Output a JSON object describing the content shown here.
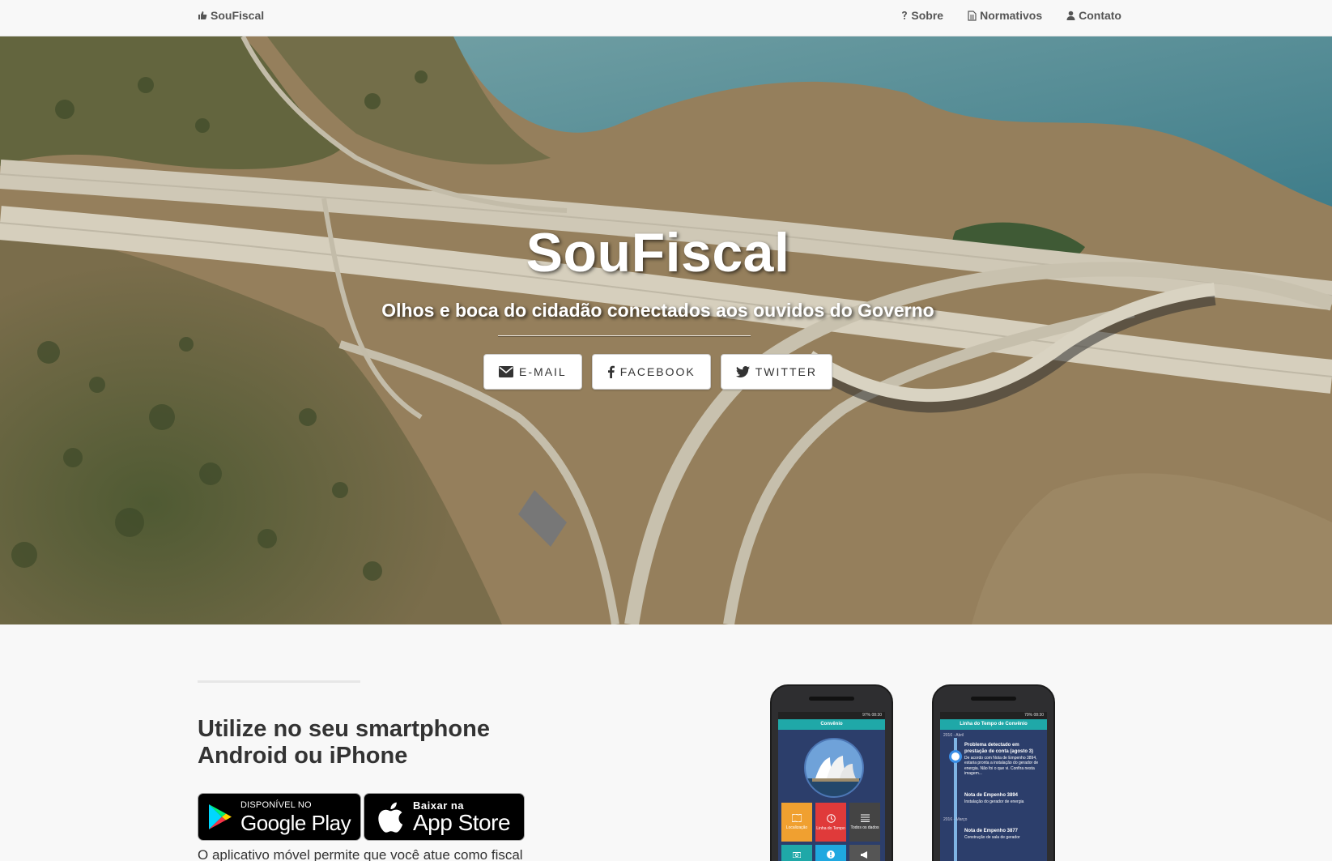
{
  "navbar": {
    "brand": "SouFiscal",
    "brand_icon": "thumbs-up-icon",
    "links": [
      {
        "label": "Sobre",
        "icon": "question-icon"
      },
      {
        "label": "Normativos",
        "icon": "file-icon"
      },
      {
        "label": "Contato",
        "icon": "user-icon"
      }
    ]
  },
  "hero": {
    "title": "SouFiscal",
    "subtitle": "Olhos e boca do cidadão conectados aos ouvidos do Governo",
    "buttons": [
      {
        "label": "E-MAIL",
        "icon": "envelope-icon"
      },
      {
        "label": "FACEBOOK",
        "icon": "facebook-icon"
      },
      {
        "label": "TWITTER",
        "icon": "twitter-icon"
      }
    ]
  },
  "section": {
    "heading": "Utilize no seu smartphone Android ou iPhone",
    "google_play": {
      "small": "DISPONÍVEL NO",
      "big": "Google Play"
    },
    "app_store": {
      "small": "Baixar na",
      "big": "App Store"
    },
    "lead": "O aplicativo móvel permite que você atue como fiscal"
  },
  "phone1": {
    "status": "97% 08:30",
    "title": "Convênio",
    "tiles": [
      {
        "label": "Localização",
        "color": "#f0a030"
      },
      {
        "label": "Linha do Tempo",
        "color": "#e03a3a"
      },
      {
        "label": "Todos os dados",
        "color": "#444"
      }
    ]
  },
  "phone2": {
    "status": "79% 08:30",
    "title": "Linha do Tempo de Convênio",
    "dates": [
      "2016 - Abril",
      "2016 - Março"
    ],
    "items": [
      {
        "title": "Problema detectado em prestação de conta (agosto 3)",
        "text": "De acordo com Nota de Empenho 3894, estaria pronta a instalação do gerador de energia. Não foi o que vi. Confira nesta imagem..."
      },
      {
        "title": "Nota de Empenho 3894",
        "text": "Instalação do gerador de energia"
      },
      {
        "title": "Nota de Empenho 3877",
        "text": "Construção de sala de gerador"
      }
    ]
  }
}
